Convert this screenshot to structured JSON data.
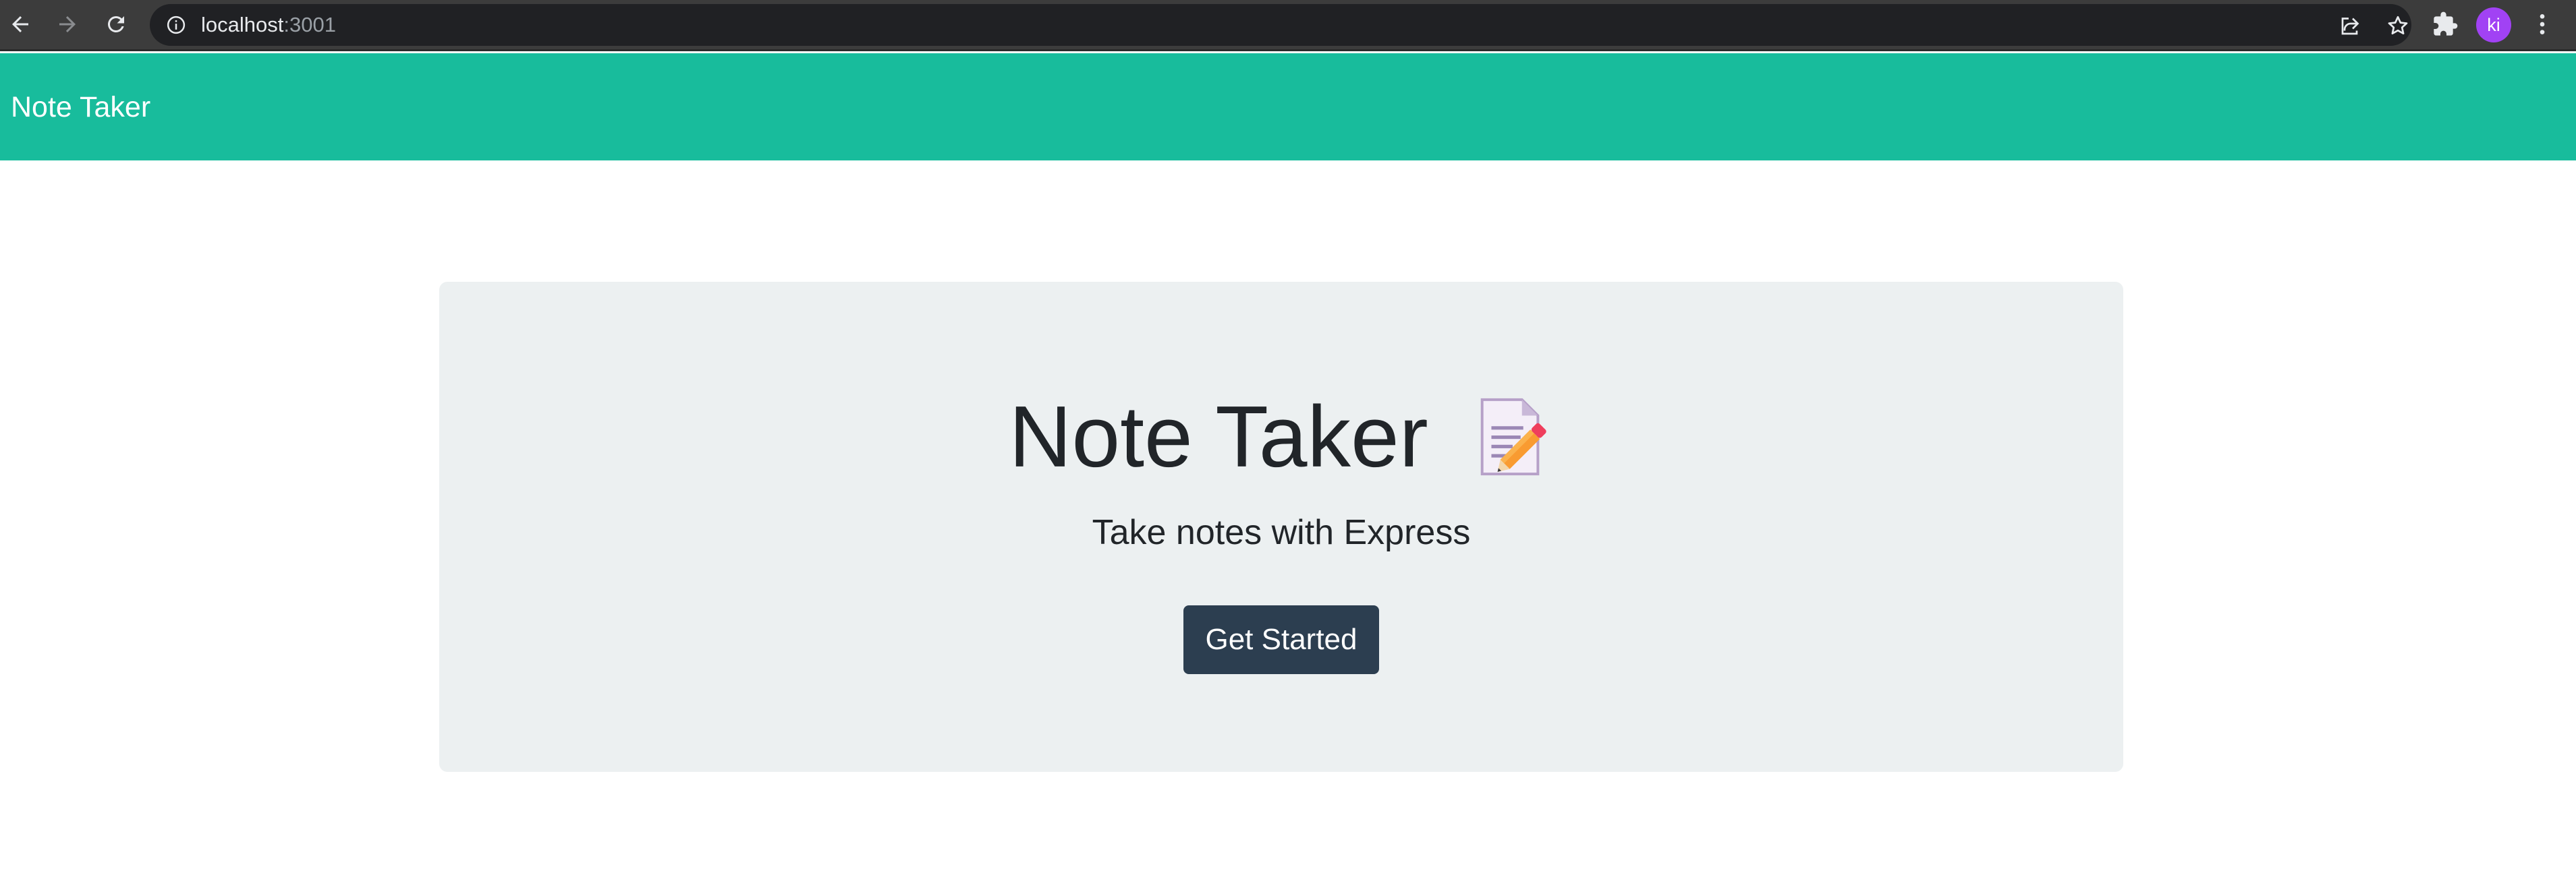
{
  "browser": {
    "url_host": "localhost",
    "url_port": ":3001",
    "profile_initials": "ki",
    "icons": {
      "back": "arrow-left-icon",
      "forward": "arrow-right-icon",
      "reload": "reload-icon",
      "site_info": "info-circle-icon",
      "share": "share-icon",
      "bookmark": "star-icon",
      "extensions": "puzzle-icon",
      "menu": "kebab-menu-icon"
    },
    "colors": {
      "toolbar": "#3c3c3c",
      "omnibox": "#202124",
      "avatar": "#a142f4"
    }
  },
  "navbar": {
    "brand": "Note Taker",
    "color": "#18bc9c"
  },
  "hero": {
    "title": "Note Taker",
    "title_icon": "memo-icon",
    "lead": "Take notes with Express",
    "button_label": "Get Started",
    "button_color": "#2c3e50",
    "background": "#ecf0f1"
  }
}
